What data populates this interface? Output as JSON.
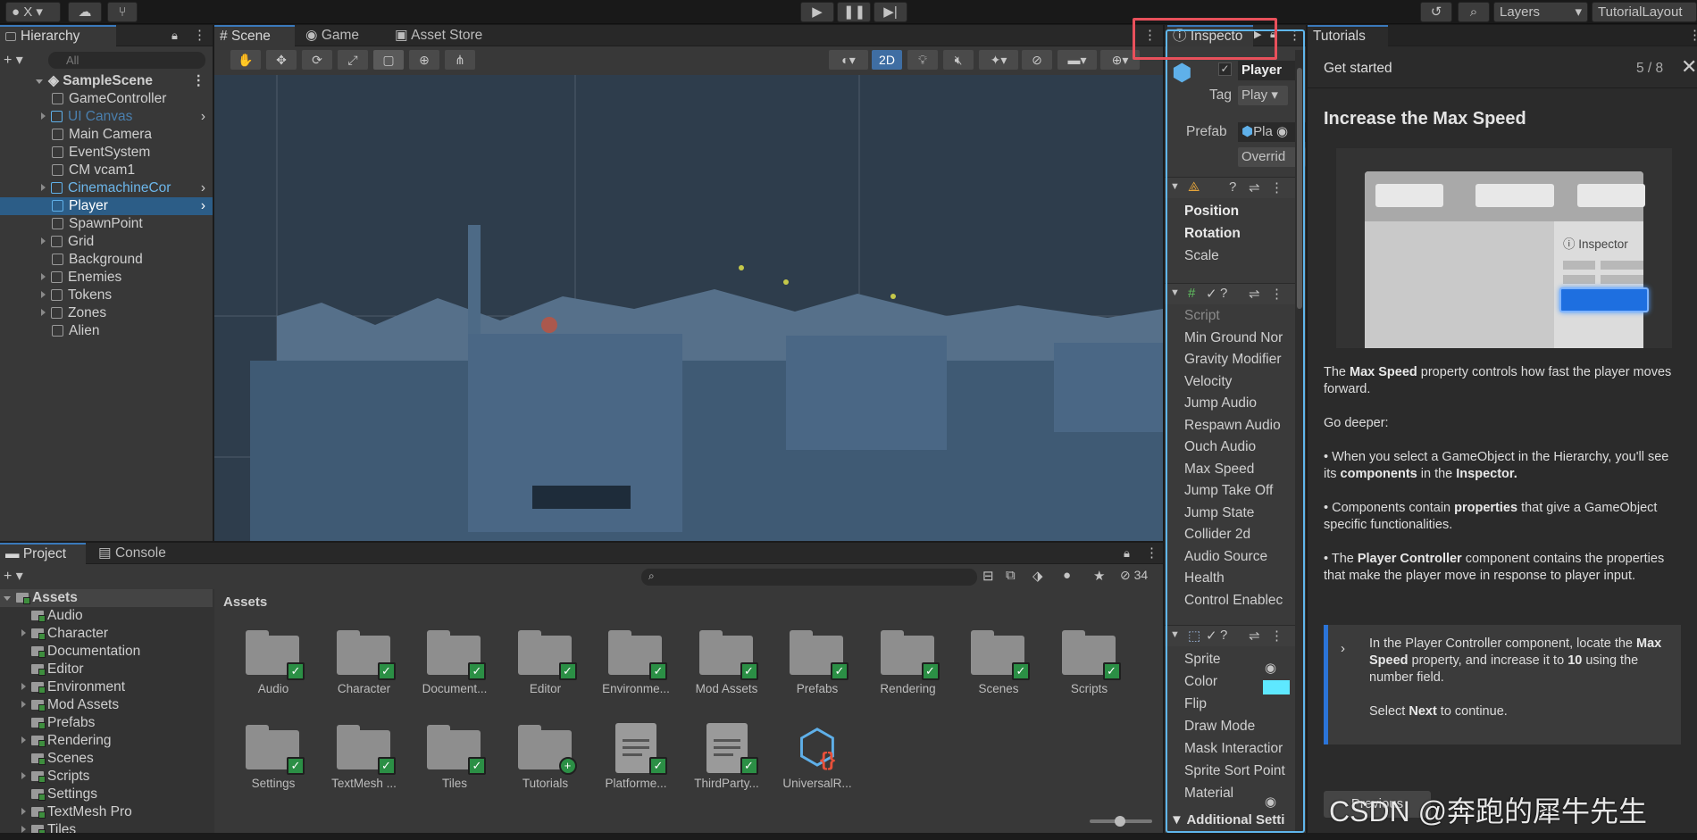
{
  "topbar": {
    "account": "X",
    "layers": "Layers",
    "layout": "TutorialLayout"
  },
  "hierarchy": {
    "tab": "Hierarchy",
    "search_placeholder": "All",
    "scene": "SampleScene",
    "items": [
      {
        "label": "GameController"
      },
      {
        "label": "UI Canvas"
      },
      {
        "label": "Main Camera"
      },
      {
        "label": "EventSystem"
      },
      {
        "label": "CM vcam1"
      },
      {
        "label": "CinemachineCor"
      },
      {
        "label": "Player"
      },
      {
        "label": "SpawnPoint"
      },
      {
        "label": "Grid"
      },
      {
        "label": "Background"
      },
      {
        "label": "Enemies"
      },
      {
        "label": "Tokens"
      },
      {
        "label": "Zones"
      },
      {
        "label": "Alien"
      }
    ]
  },
  "scene_tabs": {
    "scene": "Scene",
    "game": "Game",
    "asset_store": "Asset Store",
    "two_d": "2D"
  },
  "inspector": {
    "tab": "Inspecto",
    "object_name": "Player",
    "tag_label": "Tag",
    "tag_value": "Play",
    "prefab_label": "Prefab",
    "prefab_value": "Pla",
    "overrides": "Overrid",
    "transform": [
      "Position",
      "Rotation",
      "Scale"
    ],
    "script_props": [
      "Script",
      "Min Ground Nor",
      "Gravity Modifier",
      "Velocity",
      "Jump Audio",
      "Respawn Audio",
      "Ouch Audio",
      "Max Speed",
      "Jump Take Off",
      "Jump State",
      "Collider 2d",
      "Audio Source",
      "Health",
      "Control Enablec"
    ],
    "sprite_props": [
      "Sprite",
      "Color",
      "Flip",
      "Draw Mode",
      "Mask Interactior",
      "Sprite Sort Point",
      "Material"
    ],
    "additional": "Additional Setti",
    "sprite_color": "#5ee8ff"
  },
  "project": {
    "tab_project": "Project",
    "tab_console": "Console",
    "count": "34",
    "tree_root": "Assets",
    "tree": [
      "Audio",
      "Character",
      "Documentation",
      "Editor",
      "Environment",
      "Mod Assets",
      "Prefabs",
      "Rendering",
      "Scenes",
      "Scripts",
      "Settings",
      "TextMesh Pro",
      "Tiles"
    ],
    "grid_title": "Assets",
    "row1": [
      "Audio",
      "Character",
      "Document...",
      "Editor",
      "Environme...",
      "Mod Assets",
      "Prefabs",
      "Rendering",
      "Scenes",
      "Scripts"
    ],
    "row2": [
      "Settings",
      "TextMesh ...",
      "Tiles",
      "Tutorials",
      "Platforme...",
      "ThirdParty...",
      "UniversalR..."
    ]
  },
  "tutorials": {
    "tab": "Tutorials",
    "header": "Get started",
    "progress": "5 / 8",
    "title": "Increase the Max Speed",
    "illus_label": "Inspector",
    "p1_a": "The ",
    "p1_b": "Max Speed",
    "p1_c": " property controls how fast the player moves forward.",
    "go_deeper": "Go deeper:",
    "b1_a": "• When you select a GameObject in the Hierarchy, you'll see its ",
    "b1_b": "components",
    "b1_c": " in the ",
    "b1_d": "Inspector.",
    "b2_a": "• Components contain ",
    "b2_b": "properties",
    "b2_c": " that give a GameObject specific functionalities.",
    "b3_a": "• The ",
    "b3_b": "Player Controller",
    "b3_c": " component contains the properties that make the player move in response to player input.",
    "task_a": "In the Player Controller component, locate the ",
    "task_b": "Max Speed",
    "task_c": " property, and increase it to ",
    "task_d": "10",
    "task_e": " using the number field.",
    "task_f": "Select ",
    "task_g": "Next",
    "task_h": " to continue.",
    "previous": "Previous"
  },
  "watermark": "CSDN @奔跑的犀牛先生",
  "colors": {
    "accent": "#3a79bb",
    "highlight_box": "#e8505b",
    "inspector_outline": "#5fb6ec"
  }
}
